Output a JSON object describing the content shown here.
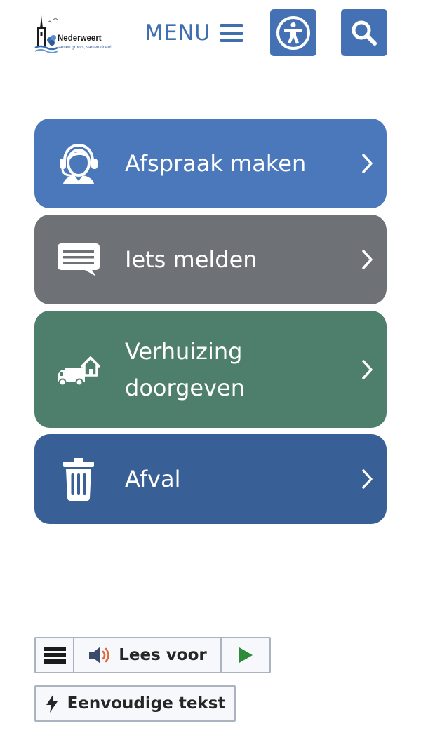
{
  "header": {
    "logo": {
      "name": "Nederweert",
      "tagline": "samen groots, samen doen!"
    },
    "menu_label": "MENU",
    "menu_icon": "hamburger-icon",
    "accessibility_icon": "accessibility-person-icon",
    "search_icon": "search-icon"
  },
  "tiles": [
    {
      "label": "Afspraak maken",
      "icon": "headset-person-icon",
      "color": "#4a78bb"
    },
    {
      "label": "Iets melden",
      "icon": "chat-bubble-icon",
      "color": "#6e7276"
    },
    {
      "label": "Verhuizing doorgeven",
      "icon": "moving-truck-house-icon",
      "color": "#4e7f6c"
    },
    {
      "label": "Afval",
      "icon": "trash-bin-icon",
      "color": "#385f96"
    }
  ],
  "readspeaker": {
    "menu_icon": "hamburger-icon",
    "read_label": "Lees voor",
    "speaker_icon": "speaker-icon",
    "play_icon": "play-icon"
  },
  "simple_text": {
    "label": "Eenvoudige tekst",
    "icon": "lightning-icon"
  },
  "colors": {
    "brand_blue": "#4470b4",
    "menu_text": "#3f6fae",
    "play_green": "#2e8b3a",
    "speaker_orange": "#e0683a"
  }
}
